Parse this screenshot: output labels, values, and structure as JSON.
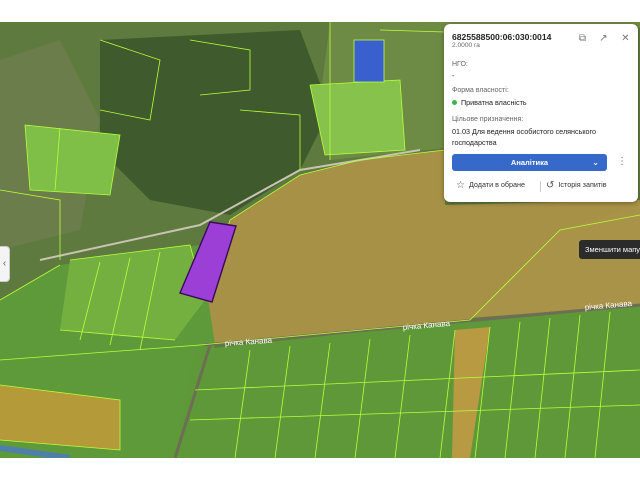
{
  "map": {
    "river_label_1": "річка Канава",
    "river_label_2": "річка Канава",
    "tooltip": "Зменшити мапу"
  },
  "panel": {
    "cadastral_number": "6825588500:06:030:0014",
    "area": "2.0000 га",
    "ngo_label": "НГО:",
    "ngo_value": "-",
    "ownership_label": "Форма власності:",
    "ownership_value": "Приватна власність",
    "purpose_label": "Цільове призначення:",
    "purpose_value_line1": "01.03 Для ведення особистого селянського",
    "purpose_value_line2": "господарства",
    "analytics_button": "Аналітика",
    "add_favorite": "Додати в обране",
    "history": "Історія запитів"
  },
  "colors": {
    "selected_parcel": "#9b3fd6",
    "blue_parcel": "#3a5fcf",
    "parcel_border": "#b8ff3a",
    "analytics_button": "#3669c9",
    "status_dot": "#3db54a"
  }
}
